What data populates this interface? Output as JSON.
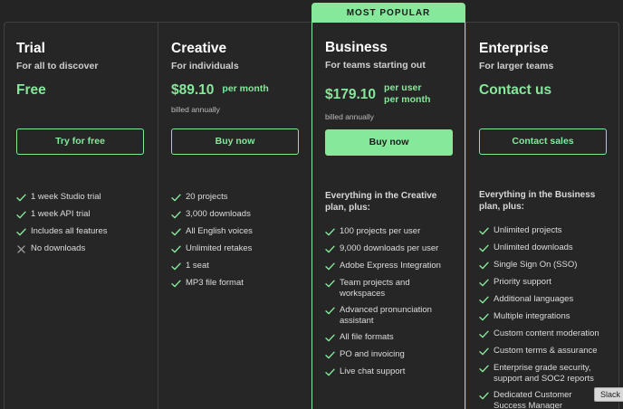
{
  "popular_badge": "MOST POPULAR",
  "plans": [
    {
      "name": "Trial",
      "subtitle": "For all to discover",
      "price": "Free",
      "cta": "Try for free",
      "features": [
        {
          "text": "1 week Studio trial",
          "icon": "check-icon"
        },
        {
          "text": "1 week API trial",
          "icon": "check-icon"
        },
        {
          "text": "Includes all features",
          "icon": "check-icon"
        },
        {
          "text": "No downloads",
          "icon": "x-icon"
        }
      ]
    },
    {
      "name": "Creative",
      "subtitle": "For individuals",
      "price": "$89.10",
      "per": "per month",
      "billed": "billed annually",
      "cta": "Buy now",
      "features": [
        {
          "text": "20 projects",
          "icon": "check-icon"
        },
        {
          "text": "3,000 downloads",
          "icon": "check-icon"
        },
        {
          "text": "All English voices",
          "icon": "check-icon"
        },
        {
          "text": "Unlimited retakes",
          "icon": "check-icon"
        },
        {
          "text": "1 seat",
          "icon": "check-icon"
        },
        {
          "text": "MP3 file format",
          "icon": "check-icon"
        }
      ]
    },
    {
      "name": "Business",
      "subtitle": "For teams starting out",
      "price": "$179.10",
      "per_line1": "per user",
      "per_line2": "per month",
      "billed": "billed annually",
      "cta": "Buy now",
      "plus": "Everything in the Creative plan, plus:",
      "features": [
        {
          "text": "100 projects per user",
          "icon": "check-icon"
        },
        {
          "text": "9,000 downloads per user",
          "icon": "check-icon"
        },
        {
          "text": "Adobe Express Integration",
          "icon": "check-icon"
        },
        {
          "text": "Team projects and workspaces",
          "icon": "check-icon"
        },
        {
          "text": "Advanced pronunciation assistant",
          "icon": "check-icon"
        },
        {
          "text": "All file formats",
          "icon": "check-icon"
        },
        {
          "text": "PO and invoicing",
          "icon": "check-icon"
        },
        {
          "text": "Live chat support",
          "icon": "check-icon"
        }
      ]
    },
    {
      "name": "Enterprise",
      "subtitle": "For larger teams",
      "price": "Contact us",
      "cta": "Contact sales",
      "plus": "Everything in the Business plan, plus:",
      "features": [
        {
          "text": "Unlimited projects",
          "icon": "check-icon"
        },
        {
          "text": "Unlimited downloads",
          "icon": "check-icon"
        },
        {
          "text": "Single Sign On (SSO)",
          "icon": "check-icon"
        },
        {
          "text": "Priority support",
          "icon": "check-icon"
        },
        {
          "text": "Additional languages",
          "icon": "check-icon"
        },
        {
          "text": "Multiple integrations",
          "icon": "check-icon"
        },
        {
          "text": "Custom content moderation",
          "icon": "check-icon"
        },
        {
          "text": "Custom terms & assurance",
          "icon": "check-icon"
        },
        {
          "text": "Enterprise grade security, support and SOC2 reports",
          "icon": "check-icon"
        },
        {
          "text": "Dedicated Customer Success Manager",
          "icon": "check-icon"
        }
      ]
    }
  ],
  "tooltip": "Slack",
  "colors": {
    "accent": "#86e89a",
    "background": "#242424",
    "border": "#3f3f3f"
  }
}
